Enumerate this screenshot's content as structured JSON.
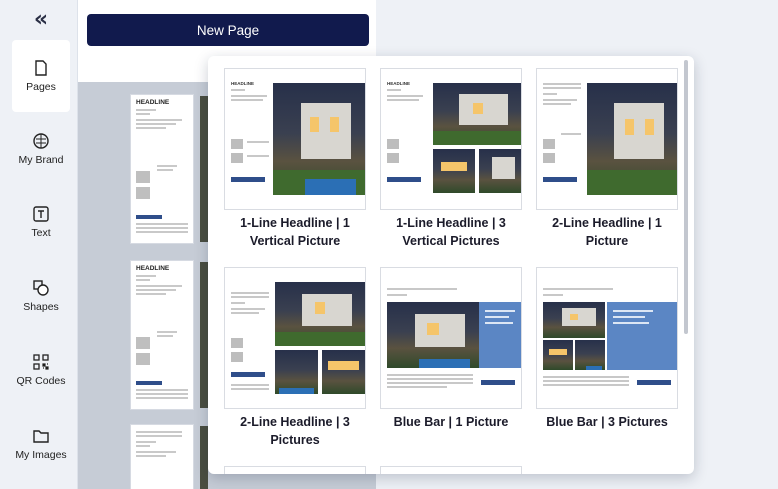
{
  "sidebar": {
    "collapse_glyph": "«",
    "items": [
      {
        "label": "Pages",
        "icon": "page-icon"
      },
      {
        "label": "My Brand",
        "icon": "palette-icon"
      },
      {
        "label": "Text",
        "icon": "text-icon"
      },
      {
        "label": "Shapes",
        "icon": "shapes-icon"
      },
      {
        "label": "QR Codes",
        "icon": "qr-code-icon"
      },
      {
        "label": "My Images",
        "icon": "folder-icon"
      }
    ]
  },
  "pages_panel": {
    "new_page_label": "New Page",
    "thumbnails": [
      {
        "title": "HEADLINE"
      },
      {
        "title": "HEADLINE"
      },
      {
        "title": ""
      }
    ]
  },
  "template_picker": {
    "templates": [
      {
        "caption": "1-Line Headline | 1 Vertical Picture"
      },
      {
        "caption": "1-Line Headline | 3 Vertical Pictures"
      },
      {
        "caption": "2-Line Headline | 1 Picture"
      },
      {
        "caption": "2-Line Headline | 3 Pictures"
      },
      {
        "caption": "Blue Bar | 1 Picture"
      },
      {
        "caption": "Blue Bar | 3 Pictures"
      }
    ]
  },
  "colors": {
    "primary_button": "#111a4d",
    "blue_bar": "#5b86c4",
    "background": "#eef1f6"
  }
}
